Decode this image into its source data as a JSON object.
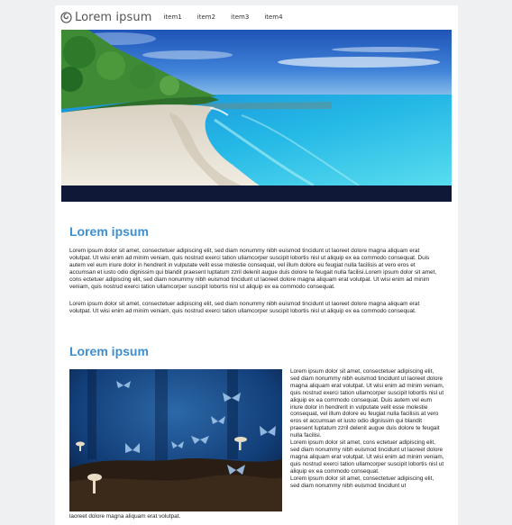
{
  "header": {
    "logo_text": "Lorem ipsum",
    "logo_icon": "spiral-logo-icon",
    "nav": [
      "item1",
      "item2",
      "item3",
      "item4"
    ]
  },
  "hero": {
    "image": "tropical-beach-photo"
  },
  "section1": {
    "title": "Lorem ipsum",
    "paragraph1": "Lorem ipsum dolor sit amet, consectetuer adipiscing elit, sed diam nonummy nibh euismod tincidunt ut laoreet dolore magna aliquam erat volutpat. Ut wisi enim ad minim veniam, quis nostrud exerci tation ullamcorper suscipit lobortis nisl ut aliquip ex ea commodo consequat. Duis autem vel eum iriure dolor in hendrerit in vulputate velit esse molestie consequat, vel illum dolore eu feugiat nulla facilisis at vero eros et accumsan et iusto odio dignissim qui blandit praesent luptatum zzril delenit augue duis dolore te feugait nulla facilisi.Lorem ipsum dolor sit amet, cons ectetuer adipiscing elit, sed diam nonummy nibh euismod tincidunt ut laoreet dolore magna aliquam erat volutpat. Ut wisi enim ad minim veniam, quis nostrud exerci tation ullamcorper suscipit lobortis nisl ut aliquip ex ea commodo consequat.",
    "paragraph2": "Lorem ipsum dolor sit amet, consectetuer adipiscing elit, sed diam nonummy nibh euismod tincidunt ut laoreet dolore magna aliquam erat volutpat. Ut wisi enim ad minim veniam, quis nostrud exerci tation ullamcorper suscipit lobortis nisl ut aliquip ex ea commodo consequat."
  },
  "section2": {
    "title": "Lorem ipsum",
    "image": "blue-butterflies-mushrooms-photo",
    "side_paragraph1": "Lorem ipsum dolor sit amet, consectetuer adipiscing elit, sed diam nonummy nibh euismod tincidunt ut laoreet dolore magna aliquam erat volutpat. Ut wisi enim ad minim veniam, quis nostrud exerci tation ullamcorper suscipit lobortis nisl ut aliquip ex ea commodo consequat. Duis autem vel eum iriure dolor in hendrerit in vulputate velit esse molestie consequat, vel illum dolore eu feugiat nulla facilisis at vero eros et accumsan et iusto odio dignissim qui blandit praesent luptatum zzril delenit augue duis dolore te feugait nulla facilisi.",
    "side_paragraph2": "Lorem ipsum dolor sit amet, cons ectetuer adipiscing elit, sed diam nonummy nibh euismod tincidunt ut laoreet dolore magna aliquam erat volutpat. Ut wisi enim ad minim veniam, quis nostrud exerci tation ullamcorper suscipit lobortis nisl ut aliquip ex ea commodo consequat.",
    "side_paragraph3": "Lorem ipsum dolor sit amet, consectetuer adipiscing elit, sed diam nonummy nibh euismod tincidunt ut",
    "bottom_text": "laoreet dolore magna aliquam erat volutpat."
  },
  "colors": {
    "page_background": "#eef0f2",
    "content_background": "#ffffff",
    "heading": "#3d8fd0",
    "hero_strip": "#0f1937"
  }
}
